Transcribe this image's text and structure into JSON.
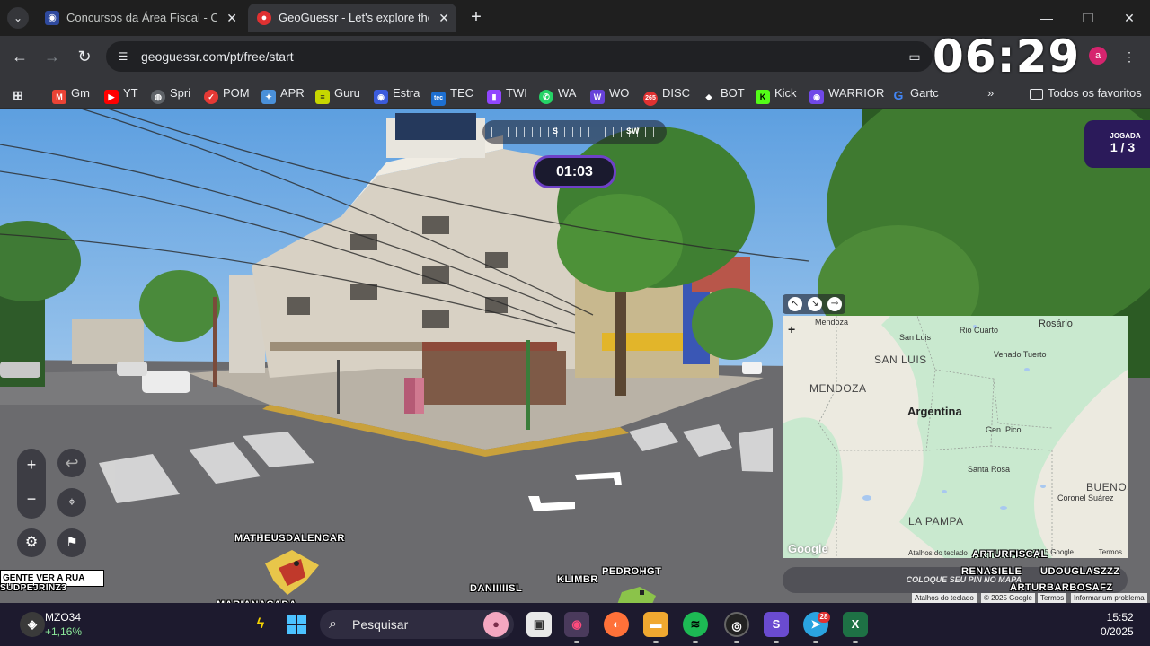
{
  "browser": {
    "tabs": [
      {
        "title": "Concursos da Área Fiscal - Curso",
        "active": false,
        "icon": "owl-icon"
      },
      {
        "title": "GeoGuessr - Let's explore the w",
        "active": true,
        "icon": "location-pin-icon"
      }
    ],
    "url": "geoguessr.com/pt/free/start",
    "overlay_clock": "06:29",
    "profile_initial": "a",
    "bookmarks": [
      {
        "label": "Gm",
        "icon": "gmail-icon",
        "color": "#ea4335"
      },
      {
        "label": "YT",
        "icon": "youtube-icon",
        "color": "#ff0000"
      },
      {
        "label": "Spri",
        "icon": "globe-icon",
        "color": "#9aa0a6"
      },
      {
        "label": "POM",
        "icon": "check-circle-icon",
        "color": "#e53935"
      },
      {
        "label": "APR",
        "icon": "apr-icon",
        "color": "#4a90d9"
      },
      {
        "label": "Guru",
        "icon": "guru-icon",
        "color": "#c6d600"
      },
      {
        "label": "Estra",
        "icon": "owl-icon",
        "color": "#3b5bdb"
      },
      {
        "label": "TEC",
        "icon": "tec-icon",
        "color": "#1d6fd1"
      },
      {
        "label": "TWI",
        "icon": "twitch-icon",
        "color": "#9146ff"
      },
      {
        "label": "WA",
        "icon": "whatsapp-icon",
        "color": "#25d366"
      },
      {
        "label": "WO",
        "icon": "wo-icon",
        "color": "#6741d9"
      },
      {
        "label": "DISC",
        "icon": "disc-icon",
        "color": "#e03131"
      },
      {
        "label": "BOT",
        "icon": "bot-icon",
        "color": "#ffffff"
      },
      {
        "label": "Kick",
        "icon": "kick-icon",
        "color": "#53fc18"
      },
      {
        "label": "WARRIOR",
        "icon": "warrior-icon",
        "color": "#7048e8"
      },
      {
        "label": "Gartc",
        "icon": "google-icon",
        "color": "#4285f4"
      }
    ],
    "all_bookmarks_label": "Todos os favoritos"
  },
  "game": {
    "compass_dirs": [
      "S",
      "SW"
    ],
    "timer": "01:03",
    "round_label": "JOGADA",
    "round_value": "1 / 3",
    "guess_prompt": "COLOQUE SEU PIN NO MAPA",
    "map": {
      "country": "Argentina",
      "regions": [
        "SAN LUIS",
        "MENDOZA",
        "LA PAMPA",
        "BUENOS AIRES"
      ],
      "cities": [
        "Mendoza",
        "San Luis",
        "Rio Cuarto",
        "Rosário",
        "Venado Tuerto",
        "Gen. Pico",
        "Santa Rosa",
        "Coronel Suárez"
      ],
      "attribution": "Atalhos do teclado",
      "data_credit": "2025 Google",
      "terms": "Termos",
      "logo": "Google"
    },
    "scene_attribution": [
      "Atalhos do teclado",
      "© 2025 Google",
      "Termos",
      "Informar um problema"
    ]
  },
  "stream_overlay": {
    "banner": "GENTE VER A RUA",
    "banner_sub": "SUDPEJRINZ3",
    "chat_names": [
      "MATHEUSDALENCAR",
      "MARIANACADA",
      "DANIIIIISL",
      "KLIMBR",
      "PEDROHGT",
      "ARTURFISCAL",
      "RENASIELE",
      "UDOUGLASZZZ",
      "ARTURBARBOSAFZ"
    ]
  },
  "taskbar": {
    "weather_label": "MZO34",
    "weather_change": "+1,16%",
    "search_placeholder": "Pesquisar",
    "time": "15:52",
    "date": "0/2025",
    "telegram_badge": "28"
  }
}
